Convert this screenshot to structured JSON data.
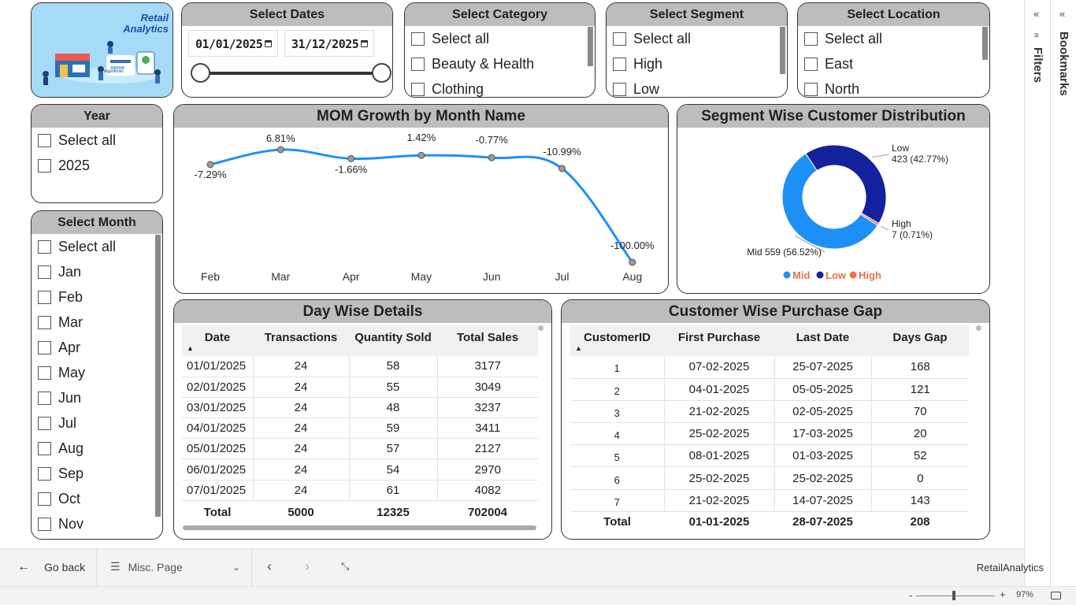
{
  "logo": {
    "title_line1": "Retail",
    "title_line2": "Analytics",
    "brand": "Algorithmix"
  },
  "dates": {
    "title": "Select Dates",
    "start": "01/01/2025",
    "end": "31/12/2025"
  },
  "category": {
    "title": "Select Category",
    "items": [
      "Select all",
      "Beauty & Health",
      "Clothing"
    ]
  },
  "segment": {
    "title": "Select Segment",
    "items": [
      "Select all",
      "High",
      "Low"
    ]
  },
  "location": {
    "title": "Select Location",
    "items": [
      "Select all",
      "East",
      "North"
    ]
  },
  "year": {
    "title": "Year",
    "items": [
      "Select all",
      "2025"
    ]
  },
  "month": {
    "title": "Select Month",
    "items": [
      "Select all",
      "Jan",
      "Feb",
      "Mar",
      "Apr",
      "May",
      "Jun",
      "Jul",
      "Aug",
      "Sep",
      "Oct",
      "Nov"
    ]
  },
  "mom": {
    "title": "MOM Growth by Month Name"
  },
  "segdist": {
    "title": "Segment Wise Customer Distribution"
  },
  "day_table": {
    "title": "Day Wise Details",
    "headers": [
      "Date",
      "Transactions",
      "Quantity Sold",
      "Total Sales"
    ],
    "rows": [
      [
        "01/01/2025",
        "24",
        "58",
        "3177"
      ],
      [
        "02/01/2025",
        "24",
        "55",
        "3049"
      ],
      [
        "03/01/2025",
        "24",
        "48",
        "3237"
      ],
      [
        "04/01/2025",
        "24",
        "59",
        "3411"
      ],
      [
        "05/01/2025",
        "24",
        "57",
        "2127"
      ],
      [
        "06/01/2025",
        "24",
        "54",
        "2970"
      ],
      [
        "07/01/2025",
        "24",
        "61",
        "4082"
      ]
    ],
    "total": [
      "Total",
      "5000",
      "12325",
      "702004"
    ]
  },
  "gap_table": {
    "title": "Customer Wise Purchase Gap",
    "headers": [
      "CustomerID",
      "First Purchase",
      "Last Date",
      "Days Gap"
    ],
    "rows": [
      [
        "1",
        "07-02-2025",
        "25-07-2025",
        "168"
      ],
      [
        "2",
        "04-01-2025",
        "05-05-2025",
        "121"
      ],
      [
        "3",
        "21-02-2025",
        "02-05-2025",
        "70"
      ],
      [
        "4",
        "25-02-2025",
        "17-03-2025",
        "20"
      ],
      [
        "5",
        "08-01-2025",
        "01-03-2025",
        "52"
      ],
      [
        "6",
        "25-02-2025",
        "25-02-2025",
        "0"
      ],
      [
        "7",
        "21-02-2025",
        "14-07-2025",
        "143"
      ]
    ],
    "total": [
      "Total",
      "01-01-2025",
      "28-07-2025",
      "208"
    ]
  },
  "panes": {
    "filters": "Filters",
    "bookmarks": "Bookmarks"
  },
  "status": {
    "go_back": "Go back",
    "page": "Misc. Page",
    "report": "RetailAnalytics",
    "zoom": "97%"
  },
  "colors": {
    "line": "#1e90f5",
    "mid": "#1e90f5",
    "low": "#14219c",
    "high": "#e8704a",
    "header": "#bdbdbd"
  },
  "chart_data": [
    {
      "type": "line",
      "title": "MOM Growth by Month Name",
      "categories": [
        "Feb",
        "Mar",
        "Apr",
        "May",
        "Jun",
        "Jul",
        "Aug"
      ],
      "values": [
        -7.29,
        6.81,
        -1.66,
        1.42,
        -0.77,
        -10.99,
        -100.0
      ],
      "labels": [
        "-7.29%",
        "6.81%",
        "-1.66%",
        "1.42%",
        "-0.77%",
        "-10.99%",
        "-100.00%"
      ]
    },
    {
      "type": "pie",
      "title": "Segment Wise Customer Distribution",
      "slices": [
        {
          "name": "Low",
          "value": 423,
          "pct": "42.77%",
          "label": "Low\n423 (42.77%)"
        },
        {
          "name": "High",
          "value": 7,
          "pct": "0.71%",
          "label": "High\n7 (0.71%)"
        },
        {
          "name": "Mid",
          "value": 559,
          "pct": "56.52%",
          "label": "Mid 559 (56.52%)"
        }
      ],
      "legend": [
        "Mid",
        "Low",
        "High"
      ]
    }
  ]
}
